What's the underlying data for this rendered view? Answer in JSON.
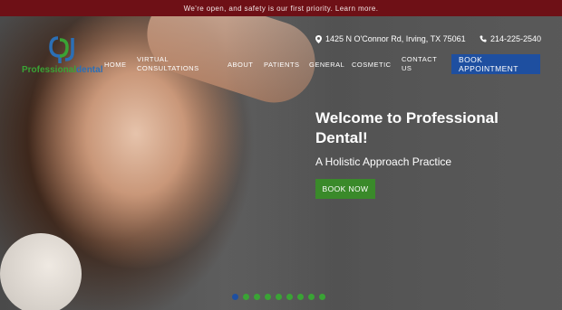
{
  "announcement": {
    "text": "We're open, and safety is our first priority. Learn more."
  },
  "logo": {
    "word_green": "Professional",
    "word_blue": "dental"
  },
  "contact": {
    "address": "1425 N O'Connor Rd, Irving, TX 75061",
    "phone": "214-225-2540"
  },
  "nav": {
    "items": [
      {
        "label": "HOME"
      },
      {
        "label": "VIRTUAL\nCONSULTATIONS"
      },
      {
        "label": "ABOUT"
      },
      {
        "label": "PATIENTS"
      },
      {
        "label": "GENERAL"
      },
      {
        "label": "COSMETIC"
      },
      {
        "label": "CONTACT\nUS"
      }
    ],
    "book_appointment": "BOOK\nAPPOINTMENT"
  },
  "hero": {
    "headline": "Welcome to Professional Dental!",
    "subheadline": "A Holistic Approach Practice",
    "cta": "BOOK NOW"
  },
  "carousel": {
    "slide_count": 9,
    "active_index": 0
  },
  "colors": {
    "announce_bg": "#6e1016",
    "brand_green": "#3aa335",
    "brand_blue": "#1e4fa0"
  }
}
